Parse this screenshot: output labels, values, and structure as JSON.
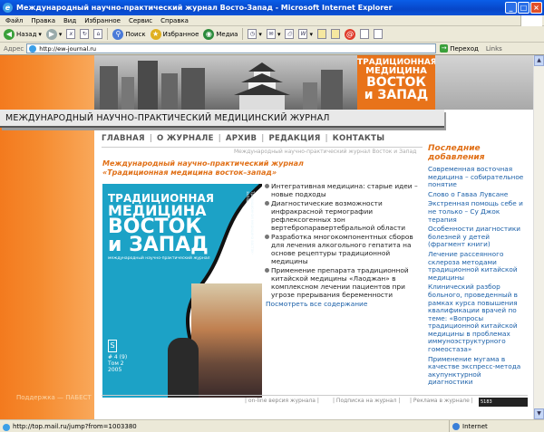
{
  "window": {
    "title": "Международный научно-практический журнал Восто-Запад - Microsoft Internet Explorer"
  },
  "menu": [
    "Файл",
    "Правка",
    "Вид",
    "Избранное",
    "Сервис",
    "Справка"
  ],
  "toolbar": {
    "back": "Назад",
    "search": "Поиск",
    "favorites": "Избранное",
    "media": "Медиа"
  },
  "address": {
    "label": "Адрес",
    "url": "http://ew-journal.ru",
    "go": "Переход",
    "links": "Links"
  },
  "site": {
    "logo": [
      "ТРАДИЦИОННАЯ",
      "МЕДИЦИНА",
      "ВОСТОК",
      "и ЗАПАД"
    ],
    "header": "МЕЖДУНАРОДНЫЙ НАУЧНО-ПРАКТИЧЕСКИЙ МЕДИЦИНСКИЙ ЖУРНАЛ",
    "nav": [
      "ГЛАВНАЯ",
      "О ЖУРНАЛЕ",
      "АРХИВ",
      "РЕДАКЦИЯ",
      "КОНТАКТЫ"
    ],
    "crumb": "Международный научно-практический журнал Восток и Запад",
    "main_title": "Международный научно-практический журнал «Традиционная медицина восток–запад»",
    "cover": {
      "t1": "ТРАДИЦИОННАЯ",
      "t2": "МЕДИЦИНА",
      "t3": "ВОСТОК",
      "t4": "и ЗАПАД",
      "sub": "международный научно-практический журнал",
      "side": "Традиционная медицина восток–запад",
      "issue": "# 4 (9)",
      "vol": "Том 2",
      "year": "2005",
      "s": "S"
    },
    "articles": [
      "Интегративная медицина: старые идеи – новые подходы",
      "Диагностические возможности инфракрасной термографии рефлексогенных зон вертебропаравертебральной области",
      "Разработка многокомпонентных сборов для лечения алкогольного гепатита на основе рецептуры традиционной медицины",
      "Применение препарата традиционной китайской медицины «Лаоджан» в комплексном лечении пациентов при угрозе прерывания беременности"
    ],
    "more": "Посмотреть все содержание",
    "recent_title": "Последние добавления",
    "recent": [
      "Современная восточная медицина – собирательное понятие",
      "Слово о Гаваа Лувсане",
      "Экстренная помощь себе и не только – Су Джок терапия",
      "Особенности диагностики болезней у детей (фрагмент книги)",
      "Лечение рассеянного склероза методами традиционной китайской медицины",
      "Клинический разбор больного, проведенный в рамках курса повышения квалификации врачей по теме: «Вопросы традиционной китайской медицины в проблемах иммуноэструктурного гомеостаза»",
      "Применение мугама в качестве экспресс-метода акупунктурной диагностики"
    ],
    "footer_left": "Поддержка — ПАБЕСТ",
    "bottom": [
      "| on-line версия журнала |",
      "| Подписка на журнал |",
      "| Реклама в журнале |"
    ],
    "counter": "5183"
  },
  "status": {
    "text": "http://top.mail.ru/jump?from=1003380",
    "zone": "Internet"
  }
}
